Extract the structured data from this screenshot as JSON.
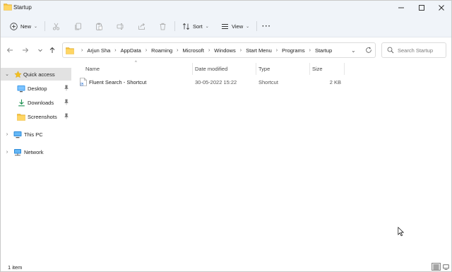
{
  "window": {
    "title": "Startup"
  },
  "commandbar": {
    "new_label": "New",
    "sort_label": "Sort",
    "view_label": "View",
    "more_label": "···"
  },
  "address": {
    "crumbs": [
      "Arjun Sha",
      "AppData",
      "Roaming",
      "Microsoft",
      "Windows",
      "Start Menu",
      "Programs",
      "Startup"
    ]
  },
  "search": {
    "placeholder": "Search Startup"
  },
  "sidebar": {
    "quick_access": "Quick access",
    "items": [
      {
        "label": "Desktop",
        "icon": "desktop-icon",
        "pinned": true
      },
      {
        "label": "Downloads",
        "icon": "downloads-icon",
        "pinned": true
      },
      {
        "label": "Screenshots",
        "icon": "folder-icon",
        "pinned": true
      }
    ],
    "this_pc": "This PC",
    "network": "Network"
  },
  "columns": {
    "name": "Name",
    "date_modified": "Date modified",
    "type": "Type",
    "size": "Size"
  },
  "files": [
    {
      "name": "Fluent Search - Shortcut",
      "date_modified": "30-05-2022 15:22",
      "type": "Shortcut",
      "size": "2 KB"
    }
  ],
  "status": {
    "item_count": "1 item"
  },
  "colors": {
    "accent": "#0067c0",
    "folder": "#f5c13d",
    "selected": "#e2e2e2",
    "chrome": "#f0f4f9"
  }
}
